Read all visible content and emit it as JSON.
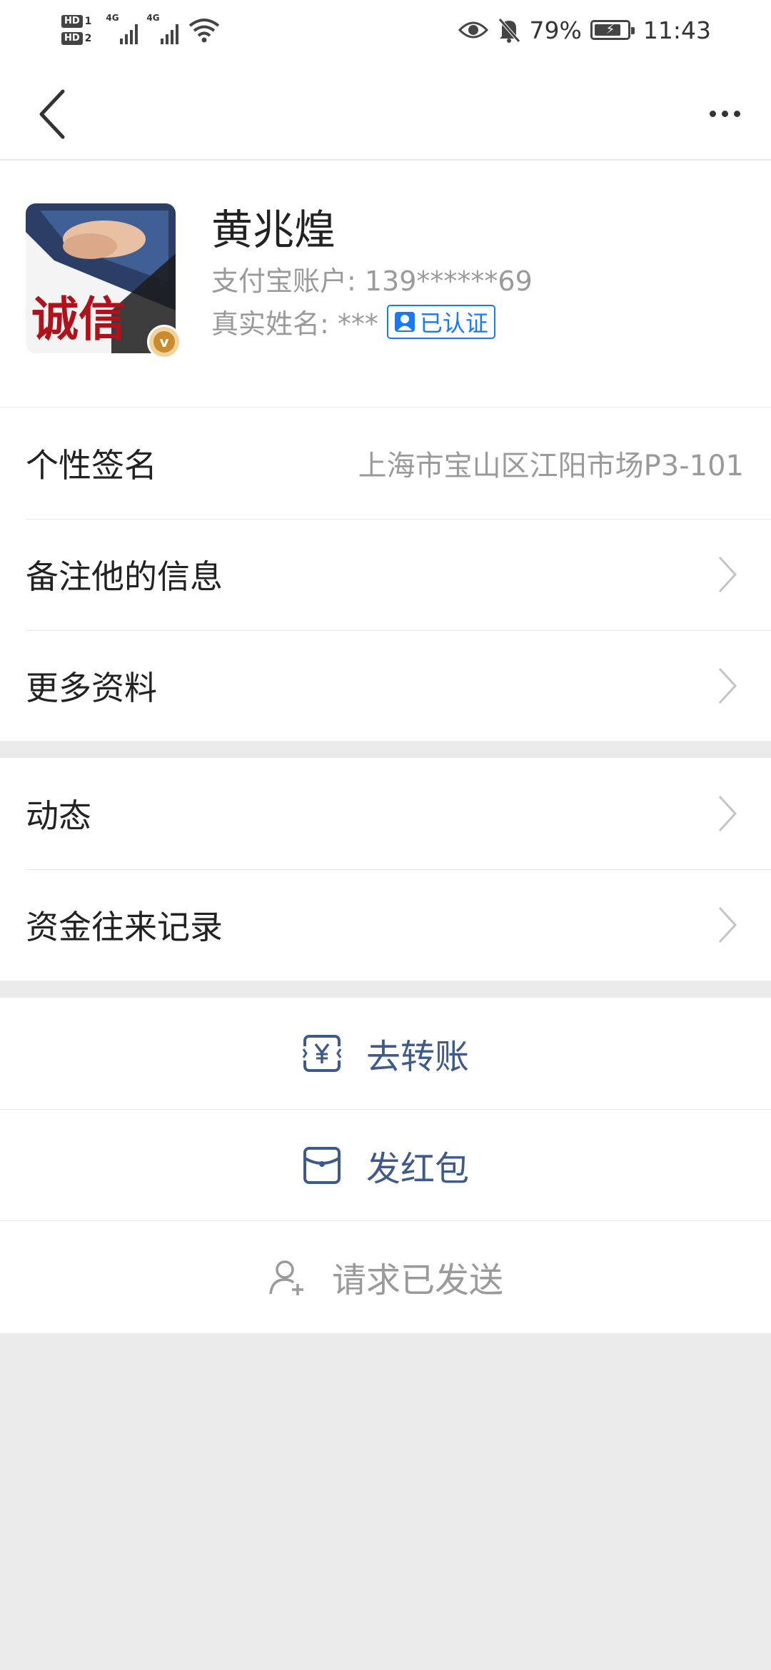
{
  "status_bar": {
    "sim1": "HD",
    "sim1_num": "1",
    "sim2": "HD",
    "sim2_num": "2",
    "net1": "4G",
    "net2": "4G",
    "battery": "79%",
    "time": "11:43"
  },
  "profile": {
    "name": "黄兆煌",
    "account_label": "支付宝账户: 139******69",
    "real_name_label": "真实姓名: ***",
    "verified_label": "已认证",
    "avatar_text": "诚信"
  },
  "info_rows": [
    {
      "label": "个性签名",
      "value": "上海市宝山区江阳市场P3-101"
    },
    {
      "label": "备注他的信息"
    },
    {
      "label": "更多资料"
    }
  ],
  "feed_rows": [
    {
      "label": "动态"
    },
    {
      "label": "资金往来记录"
    }
  ],
  "actions": {
    "transfer": "去转账",
    "red_packet": "发红包",
    "request_sent": "请求已发送"
  },
  "colors": {
    "action_blue": "#3d5a8a",
    "verified_blue": "#1677ff",
    "background_gray": "#ebebeb"
  }
}
